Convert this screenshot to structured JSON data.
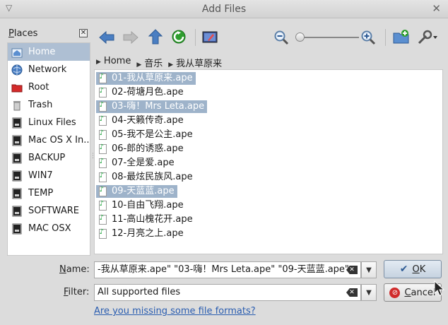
{
  "window": {
    "title": "Add Files"
  },
  "places": {
    "header_underlined": "P",
    "header_rest": "laces",
    "items": [
      {
        "label": "Home",
        "icon": "home-icon",
        "selected": true
      },
      {
        "label": "Network",
        "icon": "network-icon",
        "selected": false
      },
      {
        "label": "Root",
        "icon": "root-folder-icon",
        "selected": false
      },
      {
        "label": "Trash",
        "icon": "trash-icon",
        "selected": false
      },
      {
        "label": "Linux Files",
        "icon": "drive-icon",
        "selected": false
      },
      {
        "label": "Mac OS X In...",
        "icon": "drive-icon",
        "selected": false
      },
      {
        "label": "BACKUP",
        "icon": "drive-icon",
        "selected": false
      },
      {
        "label": "WIN7",
        "icon": "drive-icon",
        "selected": false
      },
      {
        "label": "TEMP",
        "icon": "drive-icon",
        "selected": false
      },
      {
        "label": "SOFTWARE",
        "icon": "drive-icon",
        "selected": false
      },
      {
        "label": "MAC OSX",
        "icon": "drive-icon",
        "selected": false
      }
    ]
  },
  "breadcrumb": [
    "Home",
    "音乐",
    "我从草原来"
  ],
  "files": [
    {
      "name": "01-我从草原来.ape",
      "selected": true
    },
    {
      "name": "02-荷塘月色.ape",
      "selected": false
    },
    {
      "name": "03-嗨！Mrs Leta.ape",
      "selected": true
    },
    {
      "name": "04-天籁传奇.ape",
      "selected": false
    },
    {
      "name": "05-我不是公主.ape",
      "selected": false
    },
    {
      "name": "06-郎的诱惑.ape",
      "selected": false
    },
    {
      "name": "07-全是爱.ape",
      "selected": false
    },
    {
      "name": "08-最炫民族风.ape",
      "selected": false
    },
    {
      "name": "09-天蓝蓝.ape",
      "selected": true
    },
    {
      "name": "10-自由飞翔.ape",
      "selected": false
    },
    {
      "name": "11-高山槐花开.ape",
      "selected": false
    },
    {
      "name": "12-月亮之上.ape",
      "selected": false
    }
  ],
  "form": {
    "name_label_u": "N",
    "name_label_rest": "ame:",
    "name_value": "-我从草原来.ape\" \"03-嗨！Mrs Leta.ape\" \"09-天蓝蓝.ape\"",
    "filter_label_u": "F",
    "filter_label_rest": "ilter:",
    "filter_value": "All supported files",
    "ok_u": "O",
    "ok_rest": "K",
    "cancel_u": "C",
    "cancel_rest": "ancel",
    "missing_link": "Are you missing some file formats?"
  },
  "colors": {
    "selection": "#9eb3ca",
    "link": "#2a5db0",
    "accent_green": "#2e9e2e"
  }
}
